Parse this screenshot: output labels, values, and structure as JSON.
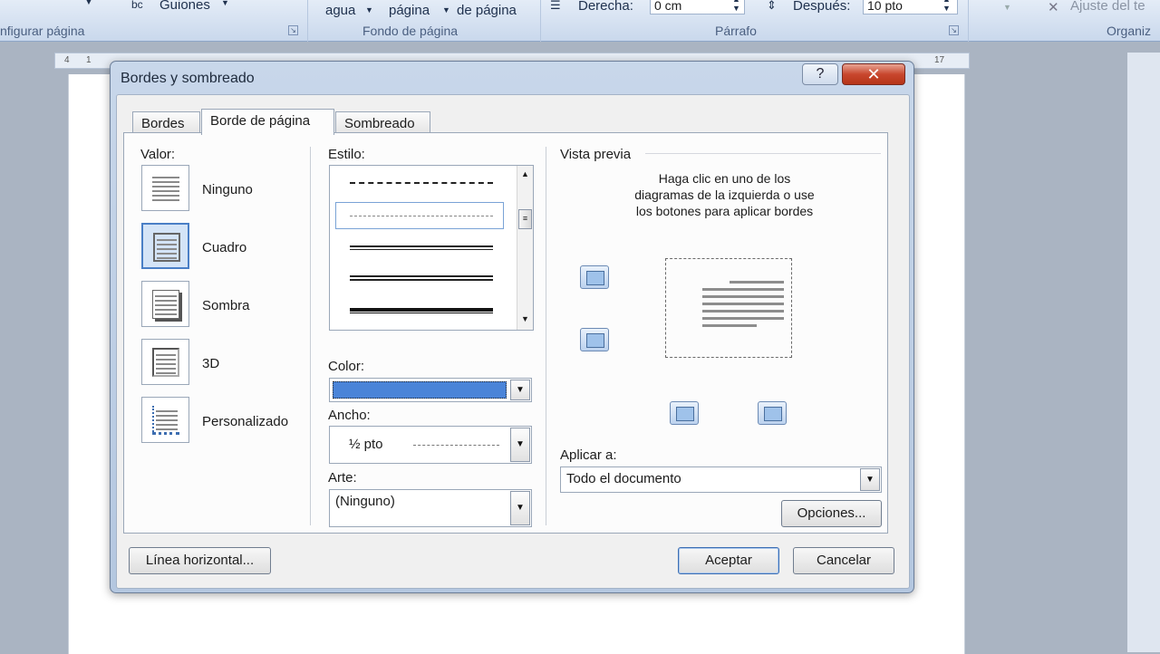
{
  "ribbon": {
    "guiones": "Guiones",
    "configurar_pagina": "nfigurar página",
    "agua": "agua",
    "color_pagina": "página",
    "bordes_pagina": "de página",
    "fondo_de_pagina": "Fondo de página",
    "derecha_label": "Derecha:",
    "derecha_value": "0 cm",
    "despues_label": "Después:",
    "despues_value": "10 pto",
    "parrafo": "Párrafo",
    "ajuste": "Ajuste del te",
    "organizar": "Organiz"
  },
  "ruler": [
    "4",
    "1",
    "17"
  ],
  "dialog": {
    "title": "Bordes y sombreado",
    "help": "?",
    "close": "✕",
    "tabs": [
      {
        "label": "Bordes"
      },
      {
        "label": "Borde de página"
      },
      {
        "label": "Sombreado"
      }
    ],
    "valor_label": "Valor:",
    "valores": [
      {
        "label": "Ninguno"
      },
      {
        "label": "Cuadro"
      },
      {
        "label": "Sombra"
      },
      {
        "label": "3D"
      },
      {
        "label": "Personalizado"
      }
    ],
    "estilo_label": "Estilo:",
    "color_label": "Color:",
    "color_value": "#4a84d8",
    "ancho_label": "Ancho:",
    "ancho_value": "½ pto",
    "arte_label": "Arte:",
    "arte_value": "(Ninguno)",
    "vista_previa_label": "Vista previa",
    "vista_instr_1": "Haga clic en uno de los",
    "vista_instr_2": "diagramas de la izquierda o use",
    "vista_instr_3": "los botones para aplicar bordes",
    "aplicar_label": "Aplicar a:",
    "aplicar_value": "Todo el documento",
    "opciones": "Opciones...",
    "linea_horizontal": "Línea horizontal...",
    "aceptar": "Aceptar",
    "cancelar": "Cancelar"
  }
}
